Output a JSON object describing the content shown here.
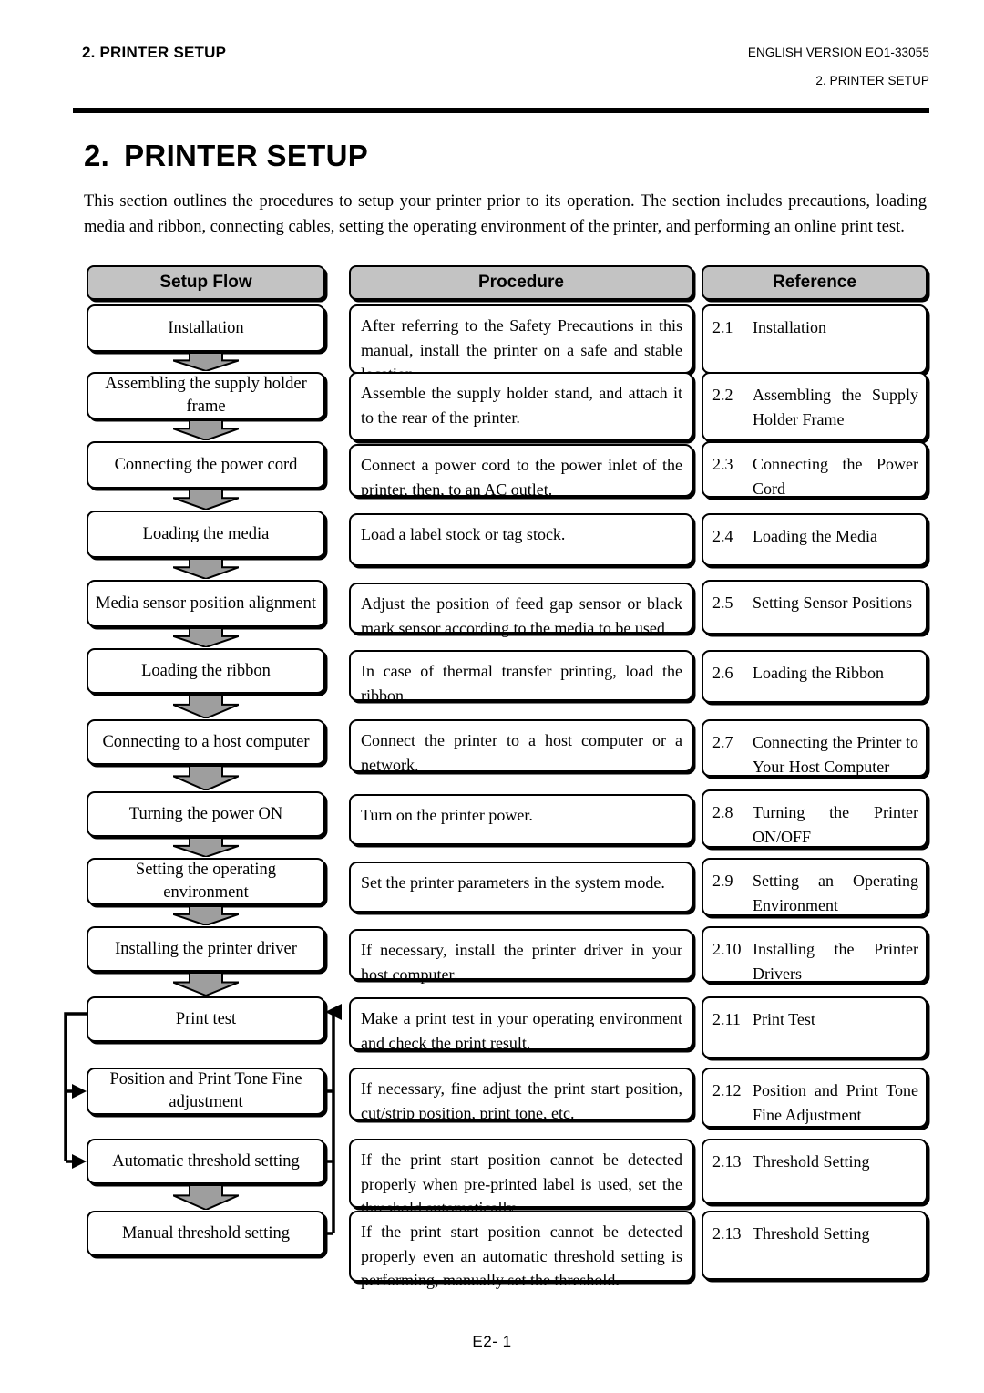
{
  "header": {
    "left_title": "2. PRINTER SETUP",
    "right_version": "ENGLISH VERSION EO1-33055",
    "right_section": "2. PRINTER SETUP"
  },
  "title": {
    "number": "2.",
    "text": "PRINTER SETUP"
  },
  "intro": "This section outlines the procedures to setup your printer prior to its operation.  The section includes precautions, loading media and ribbon, connecting cables, setting the operating environment of the printer, and performing an online print test.",
  "table": {
    "columns": [
      {
        "key": "setup_flow",
        "label": "Setup Flow"
      },
      {
        "key": "procedure",
        "label": "Procedure"
      },
      {
        "key": "reference",
        "label": "Reference"
      }
    ],
    "rows": [
      {
        "flow": "Installation",
        "procedure": "After referring to the Safety Precautions in this manual, install the printer on a safe and stable location.",
        "ref_num": "2.1",
        "ref_text": "Installation"
      },
      {
        "flow": "Assembling the supply holder frame",
        "procedure": "Assemble the supply holder stand, and attach it to the rear of the printer.",
        "ref_num": "2.2",
        "ref_text": "Assembling the Supply Holder Frame"
      },
      {
        "flow": "Connecting the power cord",
        "procedure": "Connect a power cord to the power inlet of the printer, then, to an AC outlet.",
        "ref_num": "2.3",
        "ref_text": "Connecting the Power Cord"
      },
      {
        "flow": "Loading the media",
        "procedure": "Load a label stock or tag stock.",
        "ref_num": "2.4",
        "ref_text": "Loading the Media"
      },
      {
        "flow": "Media sensor position alignment",
        "procedure": "Adjust the position of feed gap sensor or black mark sensor according to the media to be used.",
        "ref_num": "2.5",
        "ref_text": "Setting Sensor Positions"
      },
      {
        "flow": "Loading the ribbon",
        "procedure": "In case of thermal transfer printing, load the ribbon.",
        "ref_num": "2.6",
        "ref_text": "Loading the Ribbon"
      },
      {
        "flow": "Connecting to a host computer",
        "procedure": "Connect the printer to a host computer or a network.",
        "ref_num": "2.7",
        "ref_text": "Connecting the Printer to Your Host Computer"
      },
      {
        "flow": "Turning the power ON",
        "procedure": "Turn on the printer power.",
        "ref_num": "2.8",
        "ref_text": "Turning the Printer ON/OFF"
      },
      {
        "flow": "Setting the operating environment",
        "procedure": "Set the printer parameters in the system mode.",
        "ref_num": "2.9",
        "ref_text": "Setting an Operating Environment"
      },
      {
        "flow": "Installing the printer driver",
        "procedure": "If necessary, install the printer driver in your host computer.",
        "ref_num": "2.10",
        "ref_text": "Installing the Printer Drivers"
      },
      {
        "flow": "Print test",
        "procedure": "Make a print test in your operating environment and check the print result.",
        "ref_num": "2.11",
        "ref_text": "Print Test"
      },
      {
        "flow": "Position and Print Tone Fine adjustment",
        "procedure": "If necessary, fine adjust the print start position, cut/strip position, print tone, etc.",
        "ref_num": "2.12",
        "ref_text": "Position and Print Tone Fine Adjustment"
      },
      {
        "flow": "Automatic threshold setting",
        "procedure": "If the print start position cannot be detected properly when pre-printed label is used, set the threshold automatically.",
        "ref_num": "2.13",
        "ref_text": "Threshold Setting"
      },
      {
        "flow": "Manual threshold setting",
        "procedure": "If the print start position cannot be detected properly even an automatic threshold setting is performing, manually set the threshold.",
        "ref_num": "2.13",
        "ref_text": "Threshold Setting"
      }
    ]
  },
  "footer": {
    "page_label": "E2- 1"
  },
  "colors": {
    "header_fill": "#c3c3c3",
    "arrow_fill": "#9e9e9e",
    "line": "#000000",
    "page_background": "#ffffff"
  },
  "icons": {
    "flow_arrow": "down-block-arrow",
    "loop_arrow_left": "left-arrowhead",
    "loop_arrow_right": "right-arrowhead"
  }
}
